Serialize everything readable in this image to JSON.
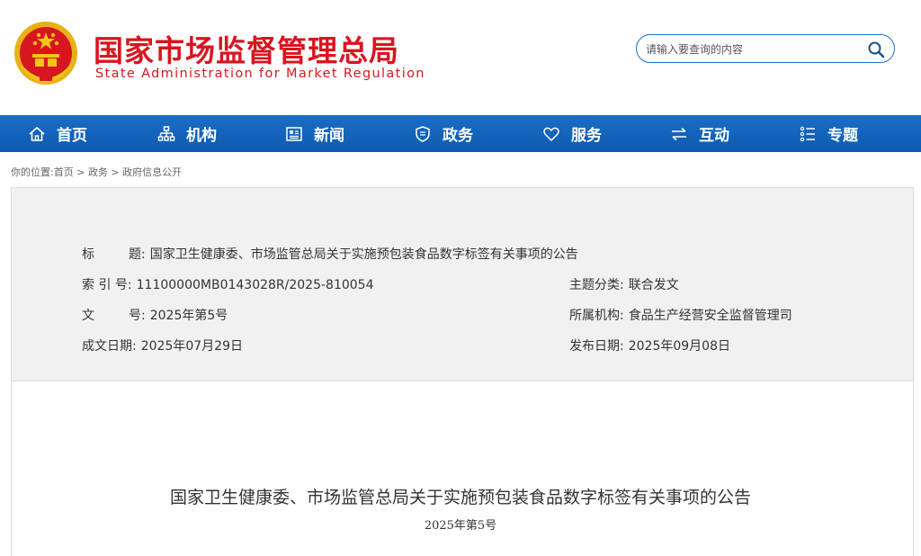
{
  "header": {
    "title": "国家市场监督管理总局",
    "subtitle": "State Administration for Market Regulation",
    "search_placeholder": "请输入要查询的内容",
    "brand_color": "#d7161f"
  },
  "nav": {
    "bg_color": "#0d5bb0",
    "items": [
      {
        "label": "首页",
        "icon": "home-icon"
      },
      {
        "label": "机构",
        "icon": "org-chart-icon"
      },
      {
        "label": "新闻",
        "icon": "newspaper-icon"
      },
      {
        "label": "政务",
        "icon": "shield-icon"
      },
      {
        "label": "服务",
        "icon": "heart-icon"
      },
      {
        "label": "互动",
        "icon": "exchange-arrows-icon"
      },
      {
        "label": "专题",
        "icon": "list-icon"
      }
    ]
  },
  "breadcrumb": {
    "prefix": "你的位置:",
    "items": [
      "首页",
      "政务",
      "政府信息公开"
    ],
    "separator": " > "
  },
  "info": {
    "title_key": "标",
    "title_key2": "题:",
    "title_value": "国家卫生健康委、市场监管总局关于实施预包装食品数字标签有关事项的公告",
    "index_key": "索 引 号:",
    "index_value": "11100000MB0143028R/2025-810054",
    "doc_key1": "文",
    "doc_key2": "号:",
    "doc_value": "2025年第5号",
    "written_key": "成文日期:",
    "written_value": "2025年07月29日",
    "topic_key": "主题分类:",
    "topic_value": "联合发文",
    "org_key": "所属机构:",
    "org_value": "食品生产经营安全监督管理司",
    "publish_key": "发布日期:",
    "publish_value": "2025年09月08日"
  },
  "document": {
    "title": "国家卫生健康委、市场监管总局关于实施预包装食品数字标签有关事项的公告",
    "number": "2025年第5号"
  }
}
